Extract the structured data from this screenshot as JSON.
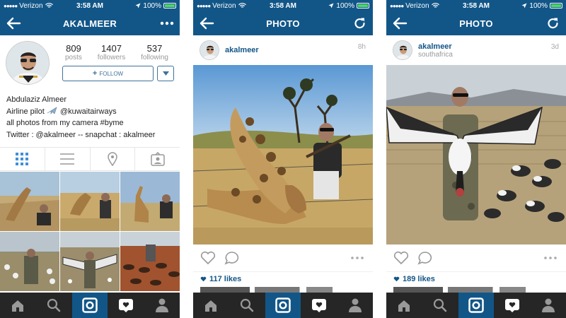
{
  "status": {
    "carrier": "Verizon",
    "time": "3:58 AM",
    "battery": "100%"
  },
  "colors": {
    "brand": "#125688",
    "tabbar": "#262626",
    "link": "#3f729b",
    "battery": "#4cd964"
  },
  "profile": {
    "title": "AKALMEER",
    "stats": [
      {
        "value": "809",
        "label": "posts"
      },
      {
        "value": "1407",
        "label": "followers"
      },
      {
        "value": "537",
        "label": "following"
      }
    ],
    "follow_label": "FOLLOW",
    "bio": {
      "name": "Abdulaziz Almeer",
      "line1_pre": "Airline pilot",
      "line1_post": "@kuwaitairways",
      "line2": "all photos from my camera #byme",
      "line3": "Twitter : @akalmeer -- snapchat : akalmeer"
    }
  },
  "post1": {
    "title": "PHOTO",
    "username": "akalmeer",
    "time": "8h",
    "likes": "117 likes"
  },
  "post2": {
    "title": "PHOTO",
    "username": "akalmeer",
    "location": "southafrica",
    "time": "3d",
    "likes": "189 likes"
  },
  "icons": {
    "nav_back": "arrow-left-icon",
    "nav_more": "ellipsis-icon",
    "nav_refresh": "refresh-icon",
    "tabs": [
      "home-icon",
      "search-icon",
      "camera-icon",
      "activity-icon",
      "profile-icon"
    ],
    "views": [
      "grid-view-icon",
      "list-view-icon",
      "map-pin-icon",
      "tagged-icon"
    ]
  }
}
